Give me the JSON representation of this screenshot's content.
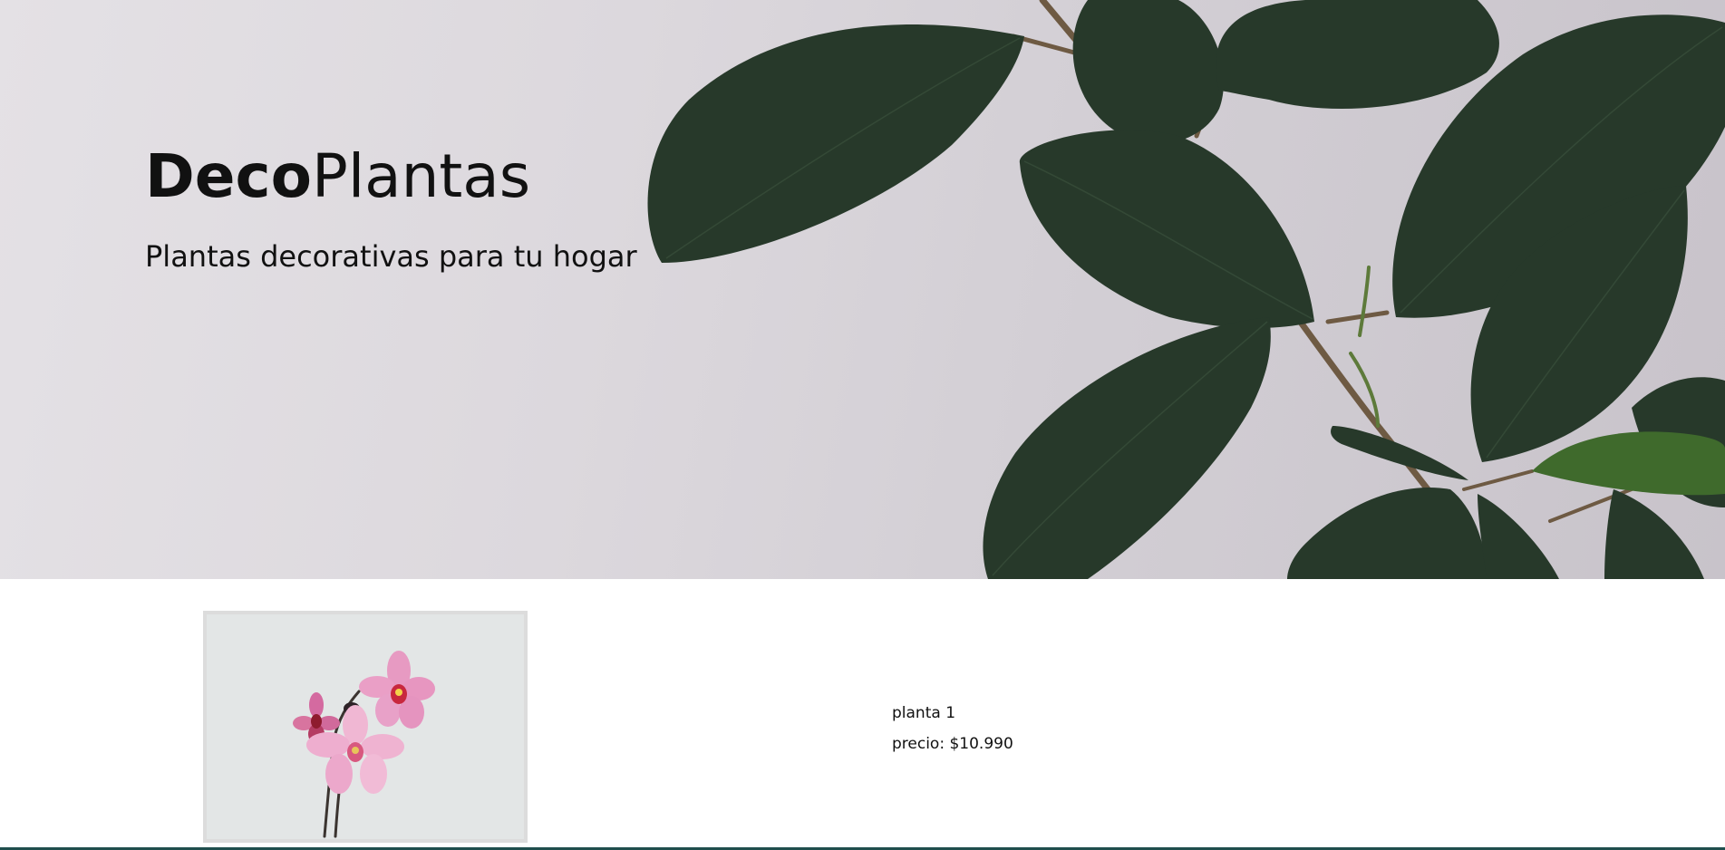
{
  "hero": {
    "brand_bold": "Deco",
    "brand_regular": "Plantas",
    "tagline": "Plantas decorativas para tu hogar",
    "icon": "ficus-plant-image"
  },
  "product": {
    "image_icon": "orchid-image",
    "name": "planta 1",
    "price": "precio: $10.990"
  },
  "colors": {
    "hero_background": "#dcd8dd",
    "leaf_dark": "#27392a",
    "stem": "#6e5a43",
    "text": "#111111",
    "image_border": "#dcdcdc",
    "bottom_strip": "#1f4e4d"
  }
}
